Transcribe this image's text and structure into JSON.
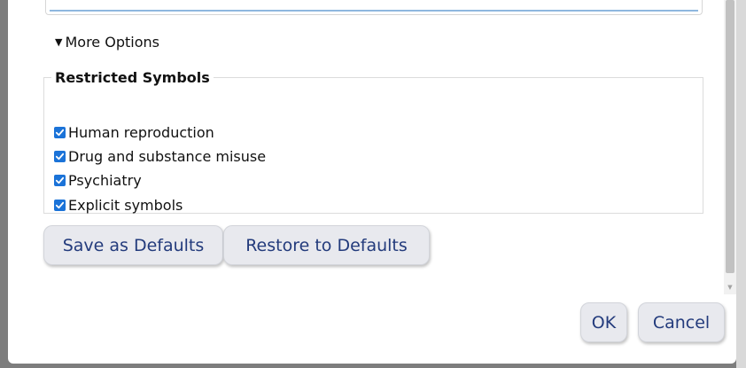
{
  "more_options": {
    "label": "More Options"
  },
  "restricted": {
    "legend": "Restricted Symbols",
    "options": [
      {
        "label": "Human reproduction",
        "checked": true
      },
      {
        "label": "Drug and substance misuse",
        "checked": true
      },
      {
        "label": "Psychiatry",
        "checked": true
      },
      {
        "label": "Explicit symbols",
        "checked": true
      }
    ]
  },
  "buttons": {
    "save_defaults": "Save as Defaults",
    "restore_defaults": "Restore to Defaults",
    "ok": "OK",
    "cancel": "Cancel"
  },
  "colors": {
    "checkbox": "#1b73d8",
    "button_text": "#233b7c",
    "button_bg": "#e8e9ee"
  }
}
